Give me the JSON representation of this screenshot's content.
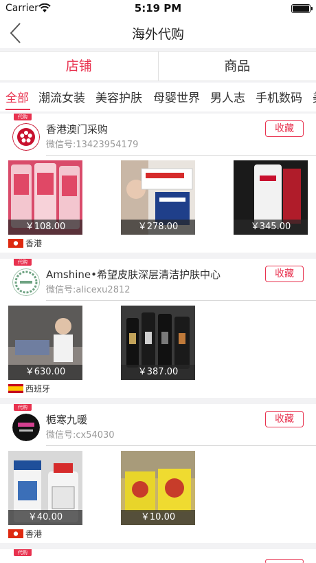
{
  "status_bar": {
    "carrier": "Carrier",
    "time": "5:19 PM"
  },
  "nav": {
    "title": "海外代购"
  },
  "segment": {
    "tabs": [
      {
        "label": "店铺",
        "active": true
      },
      {
        "label": "商品",
        "active": false
      }
    ]
  },
  "categories": [
    "全部",
    "潮流女装",
    "美容护肤",
    "母婴世界",
    "男人志",
    "手机数码",
    "美"
  ],
  "badge_label": "代购",
  "shops": [
    {
      "name": "香港澳门采购",
      "wechat": "微信号:13423954179",
      "follow_label": "收藏",
      "region": "香港",
      "products": [
        {
          "price": "￥108.00"
        },
        {
          "price": "￥278.00"
        },
        {
          "price": "￥345.00"
        }
      ]
    },
    {
      "name": "Amshine•希望皮肤深层清洁护肤中心",
      "wechat": "微信号:alicexu2812",
      "follow_label": "收藏",
      "region": "西班牙",
      "products": [
        {
          "price": "￥630.00"
        },
        {
          "price": "￥387.00"
        }
      ]
    },
    {
      "name": "栀寒九暖",
      "wechat": "微信号:cx54030",
      "follow_label": "收藏",
      "region": "香港",
      "products": [
        {
          "price": "￥40.00"
        },
        {
          "price": "￥10.00"
        }
      ]
    },
    {
      "name": "",
      "wechat": "",
      "follow_label": "",
      "region": "",
      "products": []
    }
  ],
  "colors": {
    "accent": "#e8324f",
    "background": "#f2f2f4"
  }
}
